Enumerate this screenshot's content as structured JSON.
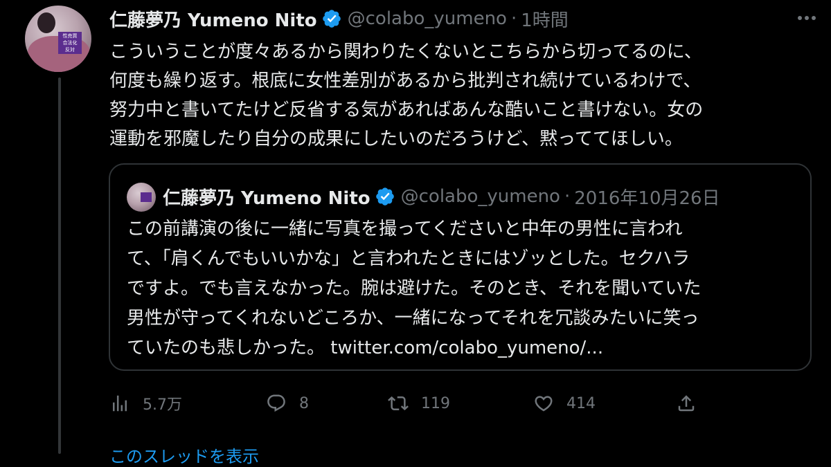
{
  "tweet": {
    "author_name": "仁藤夢乃 Yumeno Nito",
    "handle": "@colabo_yumeno",
    "separator": "·",
    "time": "1時間",
    "avatar_sign_text": [
      "性売買",
      "合法化",
      "反対"
    ],
    "text_lines": [
      "こういうことが度々あるから関わりたくないとこちらから切ってるのに、",
      "何度も繰り返す。根底に女性差別があるから批判され続けているわけで、",
      "努力中と書いてたけど反省する気があればあんな酷いこと書けない。女の",
      "運動を邪魔したり自分の成果にしたいのだろうけど、黙っててほしい。"
    ]
  },
  "quoted_tweet": {
    "author_name": "仁藤夢乃 Yumeno Nito",
    "handle": "@colabo_yumeno",
    "separator": "·",
    "date": "2016年10月26日",
    "text_lines": [
      "この前講演の後に一緒に写真を撮ってくださいと中年の男性に言われ",
      "て、「肩くんでもいいかな」と言われたときにはゾッとした。セクハラ",
      "ですよ。でも言えなかった。腕は避けた。そのとき、それを聞いていた",
      "男性が守ってくれないどころか、一緒になってそれを冗談みたいに笑っ",
      "ていたのも悲しかった。 twitter.com/colabo_yumeno/..."
    ]
  },
  "actions": {
    "views": "5.7万",
    "replies": "8",
    "retweets": "119",
    "likes": "414"
  },
  "show_thread": "このスレッドを表示",
  "colors": {
    "background": "#000000",
    "text": "#e7e9ea",
    "secondary": "#71767b",
    "accent": "#1d9bf0",
    "border": "#2f3336"
  },
  "icons": [
    "verified-badge-icon",
    "more-icon",
    "views-icon",
    "reply-icon",
    "retweet-icon",
    "like-icon",
    "share-icon"
  ]
}
